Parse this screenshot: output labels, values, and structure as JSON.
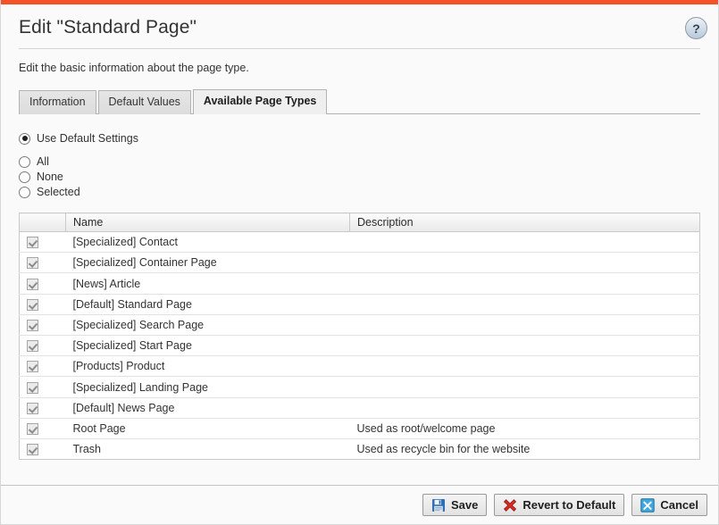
{
  "theme": {
    "accent_bar_color": "#f25329",
    "page_background": "#fafafa",
    "tab_active_background": "#efefef",
    "text_color": "#333333"
  },
  "header": {
    "title": "Edit \"Standard Page\"",
    "help_icon": "help-circle-icon",
    "help_glyph": "?"
  },
  "intro": {
    "text": "Edit the basic information about the page type."
  },
  "tabs": [
    {
      "label": "Information",
      "active": false
    },
    {
      "label": "Default Values",
      "active": false
    },
    {
      "label": "Available Page Types",
      "active": true
    }
  ],
  "radio_options": {
    "primary": {
      "label": "Use Default Settings",
      "checked": true
    },
    "group": [
      {
        "label": "All",
        "checked": false
      },
      {
        "label": "None",
        "checked": false
      },
      {
        "label": "Selected",
        "checked": false
      }
    ]
  },
  "table": {
    "columns": [
      "",
      "Name",
      "Description"
    ],
    "rows": [
      {
        "checked": true,
        "name": "[Specialized] Contact",
        "description": ""
      },
      {
        "checked": true,
        "name": "[Specialized] Container Page",
        "description": ""
      },
      {
        "checked": true,
        "name": "[News] Article",
        "description": ""
      },
      {
        "checked": true,
        "name": "[Default] Standard Page",
        "description": ""
      },
      {
        "checked": true,
        "name": "[Specialized] Search Page",
        "description": ""
      },
      {
        "checked": true,
        "name": "[Specialized] Start Page",
        "description": ""
      },
      {
        "checked": true,
        "name": "[Products] Product",
        "description": ""
      },
      {
        "checked": true,
        "name": "[Specialized] Landing Page",
        "description": ""
      },
      {
        "checked": true,
        "name": "[Default] News Page",
        "description": ""
      },
      {
        "checked": true,
        "name": "Root Page",
        "description": "Used as root/welcome page"
      },
      {
        "checked": true,
        "name": "Trash",
        "description": "Used as recycle bin for the website"
      }
    ]
  },
  "footer": {
    "buttons": [
      {
        "label": "Save",
        "icon": "save-floppy-icon"
      },
      {
        "label": "Revert to Default",
        "icon": "red-x-icon"
      },
      {
        "label": "Cancel",
        "icon": "cancel-x-icon"
      }
    ]
  }
}
